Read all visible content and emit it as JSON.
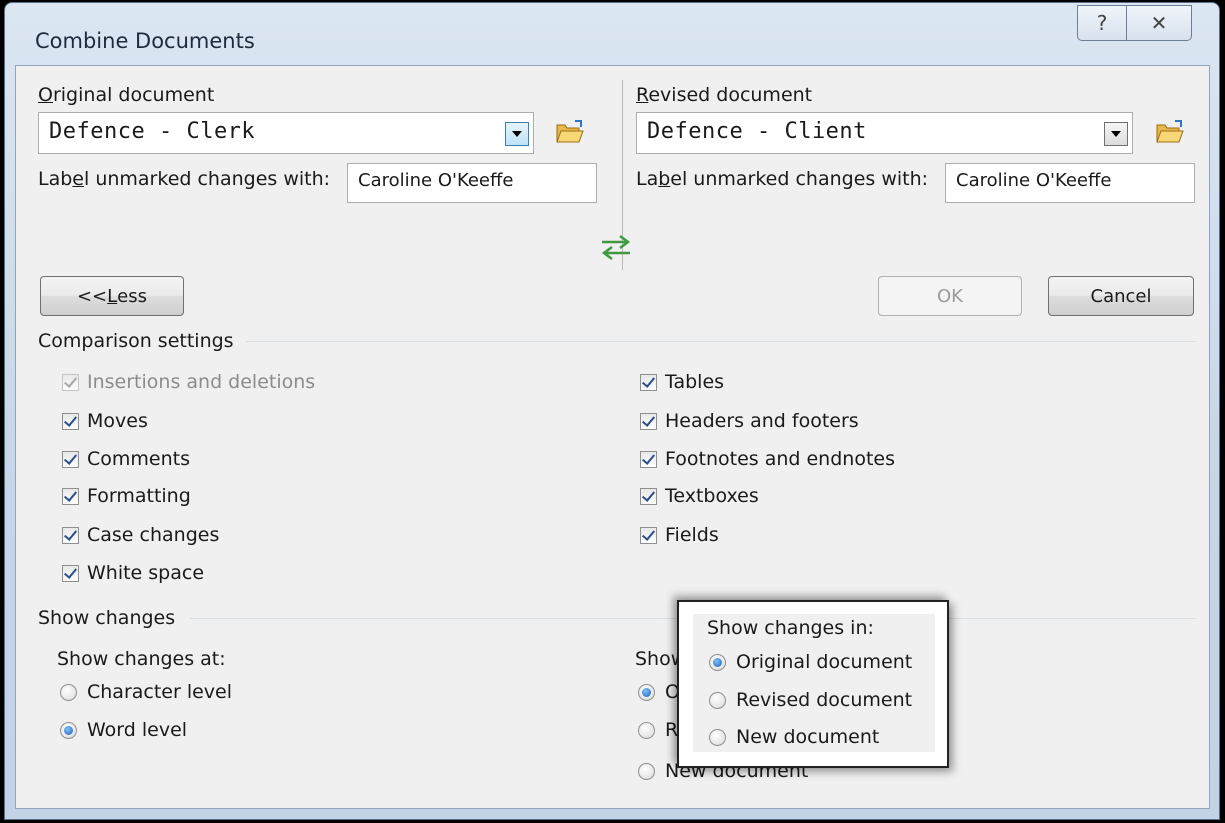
{
  "window": {
    "title": "Combine Documents",
    "help_glyph": "?",
    "close_glyph": "✕"
  },
  "original": {
    "heading": "Original document",
    "heading_accel": "O",
    "heading_rest": "riginal document",
    "value": "Defence - Clerk",
    "label_pre": "Lab",
    "label_accel": "e",
    "label_post": "l unmarked changes with:",
    "label_value": "Caroline O'Keeffe"
  },
  "revised": {
    "heading_accel": "R",
    "heading_rest": "evised document",
    "value": "Defence - Client",
    "label_pre": "La",
    "label_accel": "b",
    "label_post": "el unmarked changes with:",
    "label_value": "Caroline O'Keeffe"
  },
  "buttons": {
    "less_pre": "<< ",
    "less_accel": "L",
    "less_post": "ess",
    "ok": "OK",
    "cancel": "Cancel"
  },
  "comparison_settings": {
    "heading": "Comparison settings",
    "left": [
      {
        "label": "Insertions and deletions",
        "checked": true,
        "disabled": true
      },
      {
        "label": "Moves",
        "checked": true
      },
      {
        "label": "Comments",
        "checked": true
      },
      {
        "label": "Formatting",
        "checked": true
      },
      {
        "label": "Case changes",
        "checked": true
      },
      {
        "label": "White space",
        "checked": true
      }
    ],
    "right": [
      {
        "label": "Tables",
        "checked": true
      },
      {
        "label": "Headers and footers",
        "checked": true
      },
      {
        "label": "Footnotes and endnotes",
        "checked": true
      },
      {
        "label": "Textboxes",
        "checked": true
      },
      {
        "label": "Fields",
        "checked": true
      }
    ]
  },
  "show_changes": {
    "heading": "Show changes",
    "at_heading": "Show changes at:",
    "at_options": [
      {
        "label": "Character level",
        "selected": false
      },
      {
        "label": "Word level",
        "selected": true
      }
    ],
    "in_heading_partial": "Show",
    "in_options_partial": [
      "O",
      "R",
      "New document"
    ]
  },
  "popup": {
    "heading": "Show changes in:",
    "options": [
      {
        "label": "Original document",
        "selected": true
      },
      {
        "label": "Revised document",
        "selected": false
      },
      {
        "label": "New document",
        "selected": false
      }
    ]
  },
  "swap_icon": "swap-arrows-icon",
  "colors": {
    "title_bar": "#c6d5e7",
    "dialog_bg": "#f0f0f0",
    "radio_selected": "#1e5fb3",
    "swap_arrow": "#3f9a3f"
  }
}
